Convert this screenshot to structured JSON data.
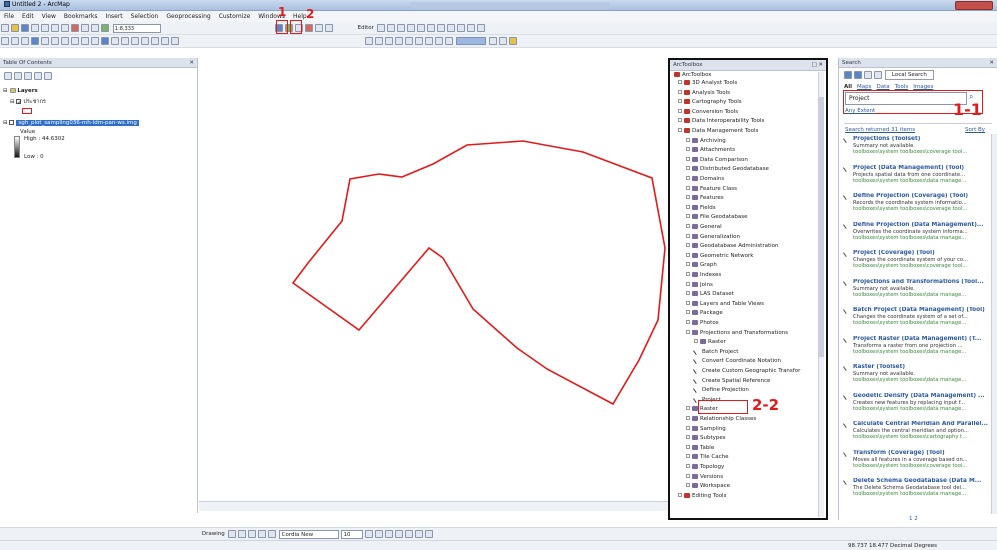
{
  "window": {
    "title": "Untitled 2 - ArcMap"
  },
  "menu": [
    "File",
    "Edit",
    "View",
    "Bookmarks",
    "Insert",
    "Selection",
    "Geoprocessing",
    "Customize",
    "Windows",
    "Help"
  ],
  "toolbar": {
    "scale": "1:8,333",
    "editor_label": "Editor"
  },
  "toc": {
    "title": "Table Of Contents",
    "layers_label": "Layers",
    "layer1": "ประชากร",
    "layer2": "sgh_plot_sampling036-mh-ldm-pan-ws.img",
    "value_label": "Value",
    "high": "High : 44.6302",
    "low": "Low : 0"
  },
  "arctoolbox": {
    "title": "ArcToolbox",
    "root": "ArcToolbox",
    "items": [
      {
        "label": "3D Analyst Tools",
        "level": 0,
        "type": "box"
      },
      {
        "label": "Analysis Tools",
        "level": 0,
        "type": "box"
      },
      {
        "label": "Cartography Tools",
        "level": 0,
        "type": "box"
      },
      {
        "label": "Conversion Tools",
        "level": 0,
        "type": "box"
      },
      {
        "label": "Data Interoperability Tools",
        "level": 0,
        "type": "box"
      },
      {
        "label": "Data Management Tools",
        "level": 0,
        "type": "box"
      },
      {
        "label": "Archiving",
        "level": 1,
        "type": "set"
      },
      {
        "label": "Attachments",
        "level": 1,
        "type": "set"
      },
      {
        "label": "Data Comparison",
        "level": 1,
        "type": "set"
      },
      {
        "label": "Distributed Geodatabase",
        "level": 1,
        "type": "set"
      },
      {
        "label": "Domains",
        "level": 1,
        "type": "set"
      },
      {
        "label": "Feature Class",
        "level": 1,
        "type": "set"
      },
      {
        "label": "Features",
        "level": 1,
        "type": "set"
      },
      {
        "label": "Fields",
        "level": 1,
        "type": "set"
      },
      {
        "label": "File Geodatabase",
        "level": 1,
        "type": "set"
      },
      {
        "label": "General",
        "level": 1,
        "type": "set"
      },
      {
        "label": "Generalization",
        "level": 1,
        "type": "set"
      },
      {
        "label": "Geodatabase Administration",
        "level": 1,
        "type": "set"
      },
      {
        "label": "Geometric Network",
        "level": 1,
        "type": "set"
      },
      {
        "label": "Graph",
        "level": 1,
        "type": "set"
      },
      {
        "label": "Indexes",
        "level": 1,
        "type": "set"
      },
      {
        "label": "Joins",
        "level": 1,
        "type": "set"
      },
      {
        "label": "LAS Dataset",
        "level": 1,
        "type": "set"
      },
      {
        "label": "Layers and Table Views",
        "level": 1,
        "type": "set"
      },
      {
        "label": "Package",
        "level": 1,
        "type": "set"
      },
      {
        "label": "Photos",
        "level": 1,
        "type": "set"
      },
      {
        "label": "Projections and Transformations",
        "level": 1,
        "type": "set"
      },
      {
        "label": "Raster",
        "level": 2,
        "type": "set"
      },
      {
        "label": "Batch Project",
        "level": 2,
        "type": "tool"
      },
      {
        "label": "Convert Coordinate Notation",
        "level": 2,
        "type": "tool"
      },
      {
        "label": "Create Custom Geographic Transfor",
        "level": 2,
        "type": "tool"
      },
      {
        "label": "Create Spatial Reference",
        "level": 2,
        "type": "tool"
      },
      {
        "label": "Define Projection",
        "level": 2,
        "type": "tool"
      },
      {
        "label": "Project",
        "level": 2,
        "type": "tool"
      },
      {
        "label": "Raster",
        "level": 1,
        "type": "set"
      },
      {
        "label": "Relationship Classes",
        "level": 1,
        "type": "set"
      },
      {
        "label": "Sampling",
        "level": 1,
        "type": "set"
      },
      {
        "label": "Subtypes",
        "level": 1,
        "type": "set"
      },
      {
        "label": "Table",
        "level": 1,
        "type": "set"
      },
      {
        "label": "Tile Cache",
        "level": 1,
        "type": "set"
      },
      {
        "label": "Topology",
        "level": 1,
        "type": "set"
      },
      {
        "label": "Versions",
        "level": 1,
        "type": "set"
      },
      {
        "label": "Workspace",
        "level": 1,
        "type": "set"
      },
      {
        "label": "Editing Tools",
        "level": 0,
        "type": "box"
      }
    ]
  },
  "search": {
    "title": "Search",
    "local_search": "Local Search",
    "filters": [
      "All",
      "Maps",
      "Data",
      "Tools",
      "Images"
    ],
    "query": "Project",
    "any_extent": "Any Extent",
    "results_count": "Search returned 31 items",
    "sort_by": "Sort By",
    "results": [
      {
        "title": "Projections (Toolset)",
        "desc": "Summary not available.",
        "path": "toolboxes\\system toolboxes\\coverage tool..."
      },
      {
        "title": "Project (Data Management) (Tool)",
        "desc": "Projects spatial data from one coordinate...",
        "path": "toolboxes\\system toolboxes\\data manage..."
      },
      {
        "title": "Define Projection (Coverage) (Tool)",
        "desc": "Records the coordinate system informatio...",
        "path": "toolboxes\\system toolboxes\\coverage tool..."
      },
      {
        "title": "Define Projection (Data Management)...",
        "desc": "Overwrites the coordinate system informa...",
        "path": "toolboxes\\system toolboxes\\data manage..."
      },
      {
        "title": "Project (Coverage) (Tool)",
        "desc": "Changes the coordinate system of your co...",
        "path": "toolboxes\\system toolboxes\\coverage tool..."
      },
      {
        "title": "Projections and Transformations (Tool...",
        "desc": "Summary not available.",
        "path": "toolboxes\\system toolboxes\\data manage..."
      },
      {
        "title": "Batch Project (Data Management) (Tool)",
        "desc": "Changes the coordinate system of a set of...",
        "path": "toolboxes\\system toolboxes\\data manage..."
      },
      {
        "title": "Project Raster (Data Management) (T...",
        "desc": "Transforms a raster from one projection ...",
        "path": "toolboxes\\system toolboxes\\data manage..."
      },
      {
        "title": "Raster (Toolset)",
        "desc": "Summary not available.",
        "path": "toolboxes\\system toolboxes\\data manage..."
      },
      {
        "title": "Geodetic Densify (Data Management) ...",
        "desc": "Creates new features by replacing input f...",
        "path": "toolboxes\\system toolboxes\\data manage..."
      },
      {
        "title": "Calculate Central Meridian And Parallel...",
        "desc": "Calculates the central meridian and option...",
        "path": "toolboxes\\system toolboxes\\cartography t..."
      },
      {
        "title": "Transform (Coverage) (Tool)",
        "desc": "Moves all features in a coverage based on...",
        "path": "toolboxes\\system toolboxes\\coverage tool..."
      },
      {
        "title": "Delete Schema Geodatabase (Data M...",
        "desc": "The Delete Schema Geodatabase tool del...",
        "path": "toolboxes\\system toolboxes\\data manage..."
      }
    ],
    "pages": "1 2"
  },
  "drawing": {
    "label": "Drawing",
    "font": "Cordia New",
    "size": "10"
  },
  "status": {
    "coords": "98.737  18.477 Decimal Degrees"
  },
  "annotations": {
    "a1": "1",
    "a2": "2",
    "a11": "1-1",
    "a22": "2-2"
  },
  "colors": {
    "polygon": "#e41a1a",
    "annotation": "#e41a1a",
    "layer_highlight": "#2f6fc9"
  }
}
